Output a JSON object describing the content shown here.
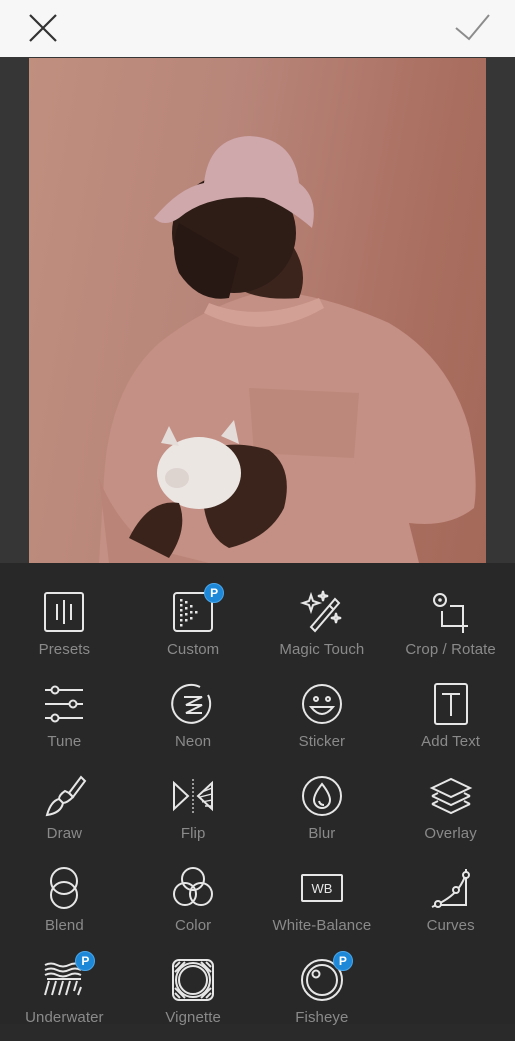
{
  "topbar": {
    "close_icon": "close-icon",
    "apply_icon": "checkmark-icon"
  },
  "photo": {
    "description": "Man in pink bucket hat and pink sweatshirt holding a white piggy bank against a pink background"
  },
  "badge_colors": {
    "pro": "#1e88d8"
  },
  "tools": [
    {
      "label": "Presets",
      "icon": "presets-icon",
      "pro": false
    },
    {
      "label": "Custom",
      "icon": "custom-icon",
      "pro": true,
      "badge": "P"
    },
    {
      "label": "Magic Touch",
      "icon": "magic-wand-icon",
      "pro": false
    },
    {
      "label": "Crop / Rotate",
      "icon": "crop-rotate-icon",
      "pro": false
    },
    {
      "label": "Tune",
      "icon": "sliders-icon",
      "pro": false
    },
    {
      "label": "Neon",
      "icon": "neon-icon",
      "pro": false
    },
    {
      "label": "Sticker",
      "icon": "smiley-icon",
      "pro": false
    },
    {
      "label": "Add Text",
      "icon": "text-icon",
      "pro": false
    },
    {
      "label": "Draw",
      "icon": "brush-icon",
      "pro": false
    },
    {
      "label": "Flip",
      "icon": "flip-icon",
      "pro": false
    },
    {
      "label": "Blur",
      "icon": "blur-drop-icon",
      "pro": false
    },
    {
      "label": "Overlay",
      "icon": "layers-icon",
      "pro": false
    },
    {
      "label": "Blend",
      "icon": "blend-icon",
      "pro": false
    },
    {
      "label": "Color",
      "icon": "color-circles-icon",
      "pro": false
    },
    {
      "label": "White-Balance",
      "icon": "white-balance-icon",
      "pro": false,
      "icon_text": "WB"
    },
    {
      "label": "Curves",
      "icon": "curves-icon",
      "pro": false
    },
    {
      "label": "Underwater",
      "icon": "underwater-icon",
      "pro": true,
      "badge": "P"
    },
    {
      "label": "Vignette",
      "icon": "vignette-icon",
      "pro": false
    },
    {
      "label": "Fisheye",
      "icon": "fisheye-icon",
      "pro": true,
      "badge": "P"
    }
  ]
}
